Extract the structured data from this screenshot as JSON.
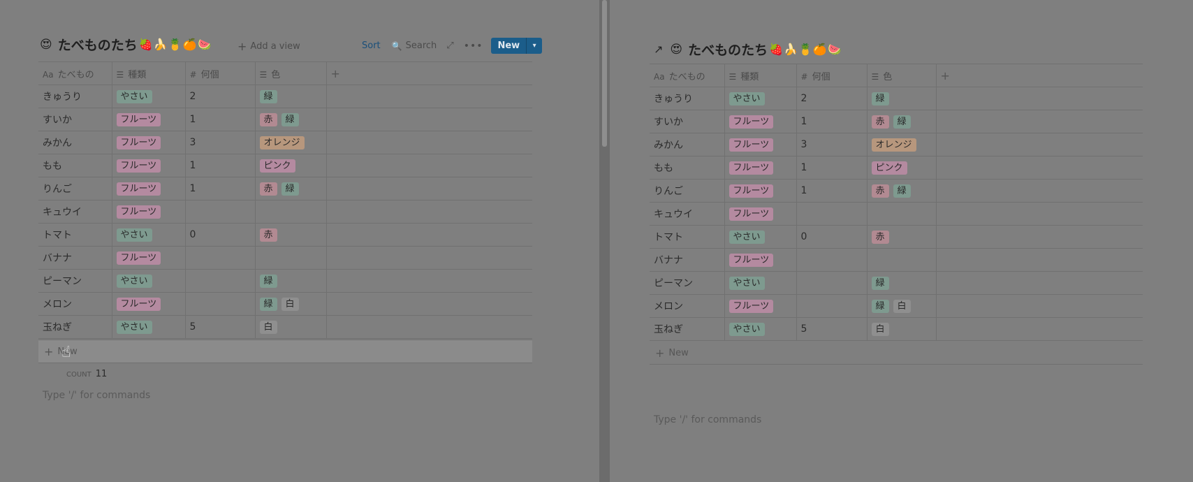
{
  "colors": {
    "tag_vegetable": "#7e9a8f",
    "tag_fruit": "#b48aa0",
    "color_red": "#b28a92",
    "color_green": "#7e9a8f",
    "color_orange": "#b7977d",
    "color_pink": "#b48aa0",
    "color_white": "#8f8f8f",
    "accent_blue": "#1b5d8a"
  },
  "icons": {
    "title_emoji": "😍",
    "fruit_emojis": "🍓🍌🍍🍊🍉",
    "arrow": "↗",
    "text_prop": "Aa",
    "list_prop": "☰",
    "number_prop": "#",
    "plus": "+",
    "search": "🔍",
    "expand": "⤢",
    "more": "•••",
    "caret": "▾",
    "cursor": "☝"
  },
  "left": {
    "title": "たべものたち",
    "add_view": "Add a view",
    "toolbar": {
      "sort": "Sort",
      "search": "Search",
      "new": "New"
    },
    "columns": [
      "たべもの",
      "種類",
      "何個",
      "色"
    ],
    "new_row": "New",
    "count_label": "COUNT",
    "count_value": "11",
    "commands": "Type '/' for commands"
  },
  "right": {
    "title": "たべものたち",
    "columns": [
      "たべもの",
      "種類",
      "何個",
      "色"
    ],
    "new_row": "New",
    "commands": "Type '/' for commands"
  },
  "rows": [
    {
      "name": "きゅうり",
      "kind": "やさい",
      "count": "2",
      "colors": [
        "緑"
      ]
    },
    {
      "name": "すいか",
      "kind": "フルーツ",
      "count": "1",
      "colors": [
        "赤",
        "緑"
      ]
    },
    {
      "name": "みかん",
      "kind": "フルーツ",
      "count": "3",
      "colors": [
        "オレンジ"
      ]
    },
    {
      "name": "もも",
      "kind": "フルーツ",
      "count": "1",
      "colors": [
        "ピンク"
      ]
    },
    {
      "name": "りんご",
      "kind": "フルーツ",
      "count": "1",
      "colors": [
        "赤",
        "緑"
      ]
    },
    {
      "name": "キュウイ",
      "kind": "フルーツ",
      "count": "",
      "colors": []
    },
    {
      "name": "トマト",
      "kind": "やさい",
      "count": "0",
      "colors": [
        "赤"
      ]
    },
    {
      "name": "バナナ",
      "kind": "フルーツ",
      "count": "",
      "colors": []
    },
    {
      "name": "ピーマン",
      "kind": "やさい",
      "count": "",
      "colors": [
        "緑"
      ]
    },
    {
      "name": "メロン",
      "kind": "フルーツ",
      "count": "",
      "colors": [
        "緑",
        "白"
      ]
    },
    {
      "name": "玉ねぎ",
      "kind": "やさい",
      "count": "5",
      "colors": [
        "白"
      ]
    }
  ]
}
